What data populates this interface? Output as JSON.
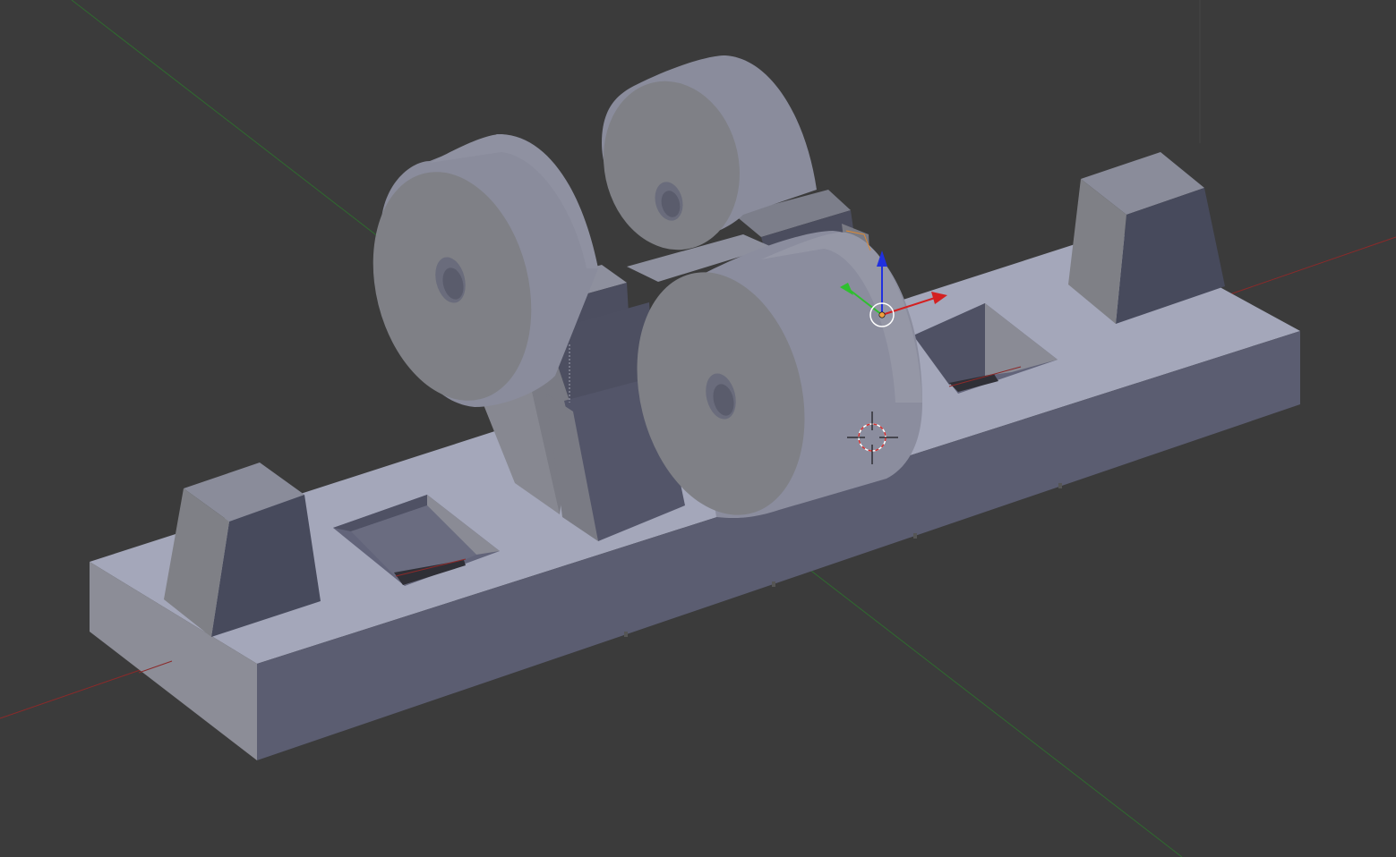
{
  "viewport": {
    "background": "#3b3b3b",
    "axis_colors": {
      "x": "#8b2a2a",
      "y": "#2f6a2f"
    },
    "mesh_colors": {
      "top": "#a3a6b9",
      "front": "#5a5c70",
      "side": "#8b8c96",
      "dark": "#4a4c5c",
      "cyl_face": "#7e7f85",
      "cyl_body": "#8a8c9c"
    },
    "gizmo_colors": {
      "x": "#d42020",
      "y": "#2ec02e",
      "z": "#2030e0",
      "center": "#f0a040"
    },
    "cursor_colors": {
      "ring_a": "#d43030",
      "ring_b": "#ffffff",
      "crosshair": "#000000"
    }
  }
}
